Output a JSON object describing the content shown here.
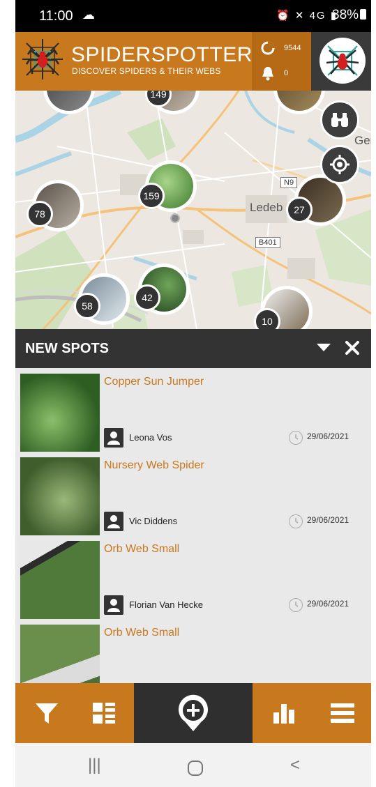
{
  "status_bar": {
    "time": "11:00",
    "weather_icon": "cloud-sun-icon",
    "network": "4G",
    "battery": "38%"
  },
  "header": {
    "title": "SPIDERSPOTTER",
    "subtitle": "DISCOVER SPIDERS & THEIR WEBS",
    "spots_count": "9544",
    "notifications_count": "0",
    "colors": {
      "accent": "#c8781d",
      "dark": "#333333"
    }
  },
  "map": {
    "clusters": [
      "149",
      "159",
      "78",
      "27",
      "58",
      "42",
      "10"
    ],
    "place_label": "Ledeb",
    "place_label_2": "Gent",
    "road_signs": [
      "N9",
      "B401"
    ]
  },
  "panel": {
    "title": "NEW SPOTS",
    "items": [
      {
        "name": "Copper Sun Jumper",
        "user": "Leona Vos",
        "date": "29/06/2021"
      },
      {
        "name": "Nursery Web Spider",
        "user": "Vic Diddens",
        "date": "29/06/2021"
      },
      {
        "name": "Orb Web Small",
        "user": "Florian Van Hecke",
        "date": "29/06/2021"
      },
      {
        "name": "Orb Web Small",
        "user": "",
        "date": ""
      }
    ]
  },
  "bottom_nav": [
    "filter-icon",
    "list-view-icon",
    "add-spot-icon",
    "statistics-icon",
    "menu-icon"
  ]
}
